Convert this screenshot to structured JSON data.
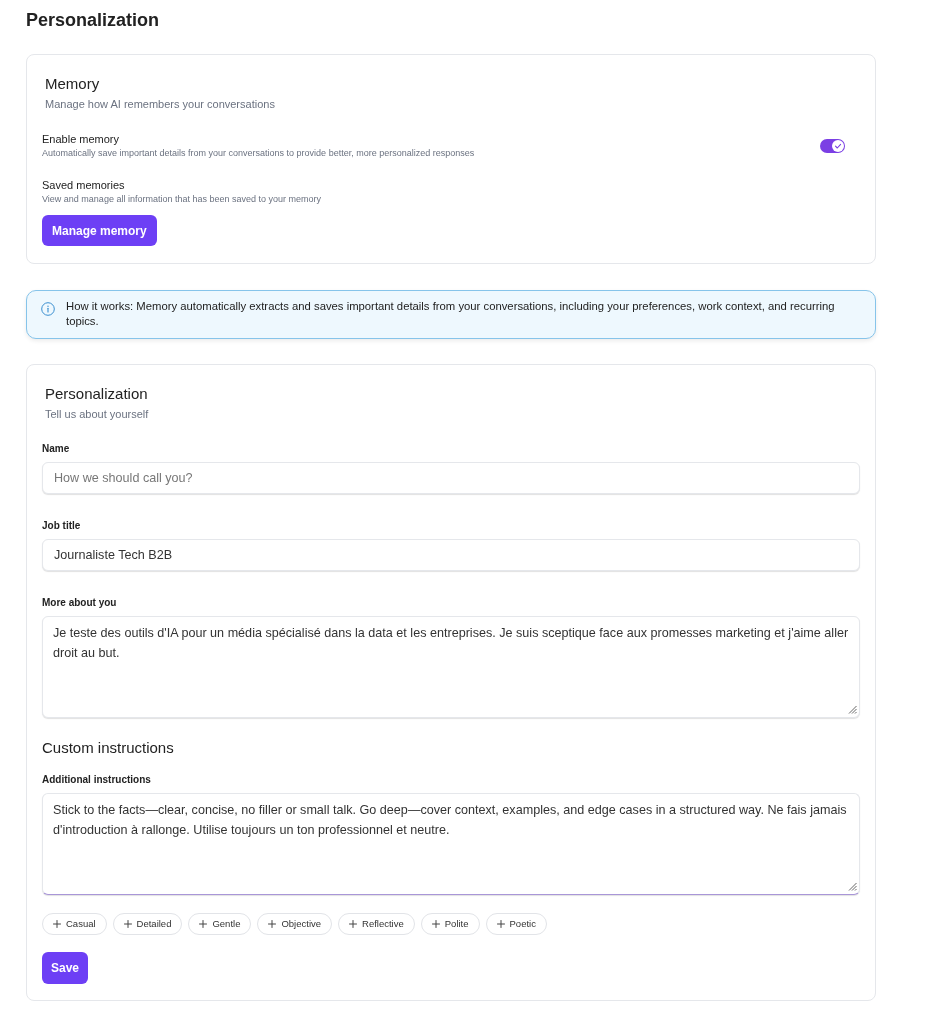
{
  "page": {
    "title": "Personalization"
  },
  "memory_card": {
    "title": "Memory",
    "subtitle": "Manage how AI remembers your conversations",
    "settings": [
      {
        "kind": "toggle",
        "label": "Enable memory",
        "description": "Automatically save important details from your conversations to provide better, more personalized responses",
        "on": true
      },
      {
        "kind": "action",
        "label": "Saved memories",
        "description": "View and manage all information that has been saved to your memory",
        "button": "Manage memory"
      }
    ]
  },
  "info_banner": {
    "text": "How it works: Memory automatically extracts and saves important details from your conversations, including your preferences, work context, and recurring topics."
  },
  "personalization_card": {
    "title": "Personalization",
    "subtitle": "Tell us about yourself",
    "fields": [
      {
        "kind": "input",
        "label": "Name",
        "placeholder": "How we should call you?",
        "focused": false
      },
      {
        "kind": "input",
        "label": "Job title",
        "value": "Journaliste Tech B2B",
        "focused": false
      },
      {
        "kind": "textarea",
        "label": "More about you",
        "value": "Je teste des outils d'IA pour un média spécialisé dans la data et les entreprises. Je suis sceptique face aux promesses marketing et j'aime aller droit au but.",
        "focused": false
      }
    ],
    "custom_instructions": {
      "title": "Custom instructions",
      "fields": [
        {
          "kind": "textarea",
          "label": "Additional instructions",
          "value": "Stick to the facts—clear, concise, no filler or small talk. Go deep—cover context, examples, and edge cases in a structured way. Ne fais jamais d'introduction à rallonge. Utilise toujours un ton professionnel et neutre.",
          "focused": true
        }
      ],
      "chips": [
        "Casual",
        "Detailed",
        "Gentle",
        "Objective",
        "Reflective",
        "Polite",
        "Poetic"
      ]
    },
    "save_button": "Save"
  }
}
